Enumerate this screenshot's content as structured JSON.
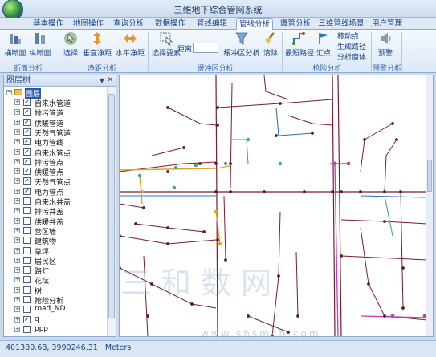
{
  "app": {
    "title": "三维地下综合管网系统"
  },
  "tabs": [
    "基本操作",
    "地图操作",
    "查询分析",
    "数据操作",
    "管线编辑",
    "管线分析",
    "爆管分析",
    "三维管线场景",
    "用户管理"
  ],
  "active_tab": "管线分析",
  "ribbon": {
    "buttons": {
      "hengduanmian": "横断面",
      "zongduanmian": "纵断面",
      "select": "选择",
      "vertical": "垂直净距",
      "horizontal": "水平净距",
      "select_elements": "选择要素",
      "distance_label": "距离",
      "distance_value": "",
      "buffer_analysis": "缓冲区分析",
      "clear": "清除",
      "shortest_path": "最短路径",
      "confluence": "汇点",
      "move_point": "移动点",
      "gen_path": "生成路径",
      "analysis_window": "分析窗体",
      "warning": "预警"
    },
    "groups": {
      "section": "断面分析",
      "clearance": "净距分析",
      "buffer": "缓冲区分析",
      "emergency": "抢险分析",
      "warning": "预警分析"
    }
  },
  "layer_panel": {
    "title": "图层树",
    "root": "图层",
    "layers": [
      {
        "name": "自来水管道",
        "checked": true,
        "expandable": true
      },
      {
        "name": "排污管道",
        "checked": true,
        "expandable": true
      },
      {
        "name": "供暖管道",
        "checked": true,
        "expandable": true
      },
      {
        "name": "天然气管道",
        "checked": true,
        "expandable": true
      },
      {
        "name": "电力管线",
        "checked": true,
        "expandable": true
      },
      {
        "name": "自来水管点",
        "checked": true,
        "expandable": true
      },
      {
        "name": "排污管点",
        "checked": true,
        "expandable": true
      },
      {
        "name": "供暖管点",
        "checked": true,
        "expandable": true
      },
      {
        "name": "天然气管点",
        "checked": true,
        "expandable": true
      },
      {
        "name": "电力管点",
        "checked": true,
        "expandable": true
      },
      {
        "name": "自来水井盖",
        "checked": false,
        "expandable": true
      },
      {
        "name": "排污井盖",
        "checked": false,
        "expandable": true
      },
      {
        "name": "供暖井盖",
        "checked": false,
        "expandable": true
      },
      {
        "name": "营区墙",
        "checked": false,
        "expandable": true
      },
      {
        "name": "建筑物",
        "checked": false,
        "expandable": true
      },
      {
        "name": "草坪",
        "checked": false,
        "expandable": true
      },
      {
        "name": "居民区",
        "checked": false,
        "expandable": true
      },
      {
        "name": "路灯",
        "checked": false,
        "expandable": true
      },
      {
        "name": "花坛",
        "checked": false,
        "expandable": true
      },
      {
        "name": "树",
        "checked": false,
        "expandable": true
      },
      {
        "name": "抢险分析",
        "checked": false,
        "expandable": true
      },
      {
        "name": "road_ND",
        "checked": false,
        "expandable": true
      },
      {
        "name": "q",
        "checked": true,
        "expandable": true
      },
      {
        "name": "ppp",
        "checked": false,
        "expandable": true
      }
    ]
  },
  "map": {
    "watermark": "三和数网",
    "watermark_url": "www.shsmch.com",
    "colors": {
      "pipe_main": "#7a1d2a",
      "pipe_water": "#2d73c9",
      "pipe_gas": "#e0a020",
      "pipe_power": "#c23ac9",
      "pipe_drain": "#3aa5a0",
      "node": "#5a1a24"
    }
  },
  "status": {
    "coords": "401380.68, 3990246.31",
    "units": "Meters"
  }
}
